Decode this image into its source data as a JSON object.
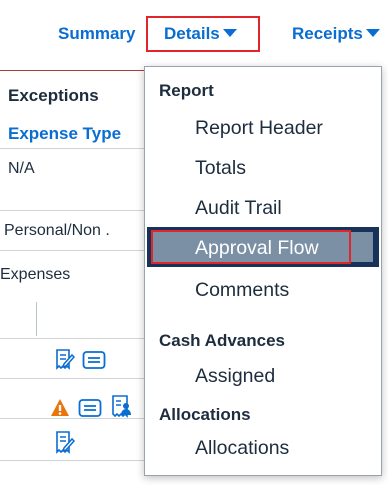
{
  "tabs": {
    "summary": "Summary",
    "details": "Details",
    "receipts": "Receipts"
  },
  "left": {
    "exceptions_heading": "Exceptions",
    "expense_type_header": "Expense Type",
    "row1_value": "N/A",
    "row2_value": "Personal/Non .",
    "expenses_label": "Expenses"
  },
  "menu": {
    "report_group": "Report",
    "report_header": "Report Header",
    "totals": "Totals",
    "audit_trail": "Audit Trail",
    "approval_flow": "Approval Flow",
    "comments": "Comments",
    "cash_advances_group": "Cash Advances",
    "assigned": "Assigned",
    "allocations_group": "Allocations",
    "allocations": "Allocations"
  },
  "colors": {
    "link_blue": "#0a6ed1",
    "highlight_red": "#e0262b",
    "selected_bg": "#7b8fa5",
    "warning_orange": "#e9730c"
  }
}
